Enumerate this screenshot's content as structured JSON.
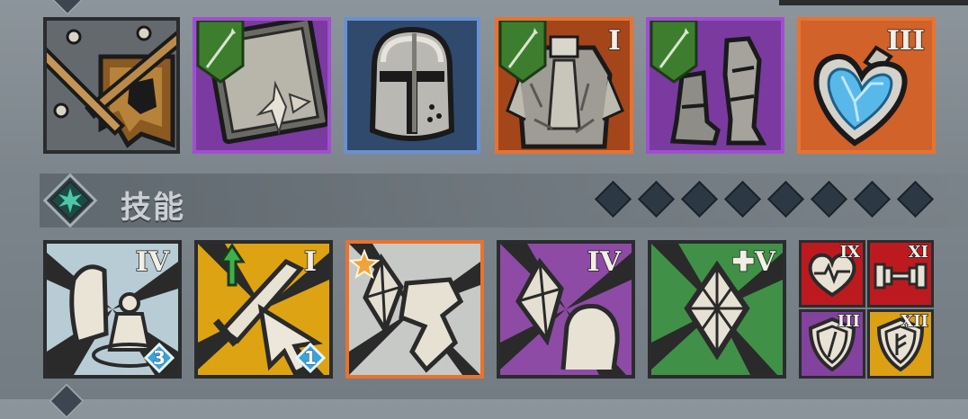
{
  "skills_section": {
    "title": "技能",
    "icon": "star-emblem-icon",
    "progress_diamonds_total": 8
  },
  "equipment": [
    {
      "name": "banner",
      "rarity": "none",
      "has_green_flag": false,
      "level": ""
    },
    {
      "name": "shield",
      "rarity": "purple",
      "has_green_flag": true,
      "level": ""
    },
    {
      "name": "helmet",
      "rarity": "blue",
      "has_green_flag": false,
      "level": ""
    },
    {
      "name": "armor",
      "rarity": "orange",
      "has_green_flag": true,
      "level": "I"
    },
    {
      "name": "boots",
      "rarity": "purple",
      "has_green_flag": true,
      "level": ""
    },
    {
      "name": "heart-amulet",
      "rarity": "orange",
      "has_green_flag": false,
      "level": "III"
    }
  ],
  "skills": [
    {
      "name": "summon-skill",
      "color": "light-blue",
      "level": "IV",
      "badge": "3"
    },
    {
      "name": "sword-skill",
      "color": "yellow",
      "level": "I",
      "badge": "1"
    },
    {
      "name": "crystal-strike-skill",
      "color": "orange",
      "level": "",
      "star": true
    },
    {
      "name": "crystal-arm-skill",
      "color": "purple",
      "level": "IV"
    },
    {
      "name": "crystal-skill",
      "color": "green",
      "level": "✚V"
    }
  ],
  "passives": [
    {
      "name": "heart-passive",
      "color": "red",
      "level": "IX"
    },
    {
      "name": "dumbbell-passive",
      "color": "red",
      "level": "XI"
    },
    {
      "name": "shield-passive",
      "color": "purple",
      "level": "III"
    },
    {
      "name": "rune-shield-passive",
      "color": "yellow",
      "level": "XII"
    }
  ],
  "colors": {
    "purple": "#a04fd0",
    "blue": "#5f86c4",
    "orange": "#e8732f",
    "yellow": "#e0a50e",
    "green": "#3f8a46",
    "red": "#c0141c",
    "frame": "#2a2c2e"
  }
}
